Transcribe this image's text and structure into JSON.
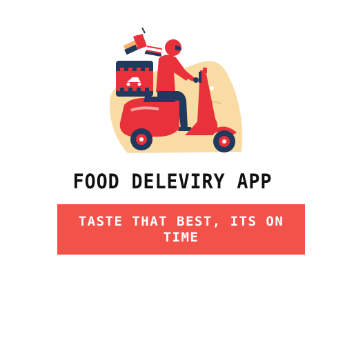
{
  "brand": {
    "title": "FOOD DELEVIRY APP",
    "tagline": "TASTE THAT BEST, ITS ON TIME"
  },
  "illustration": {
    "icon": "delivery-scooter-rider-icon"
  },
  "colors": {
    "accent": "#f2524a",
    "scooter": "#e8313a",
    "navy": "#22395e",
    "sand": "#f8dca4",
    "text": "#111111"
  }
}
